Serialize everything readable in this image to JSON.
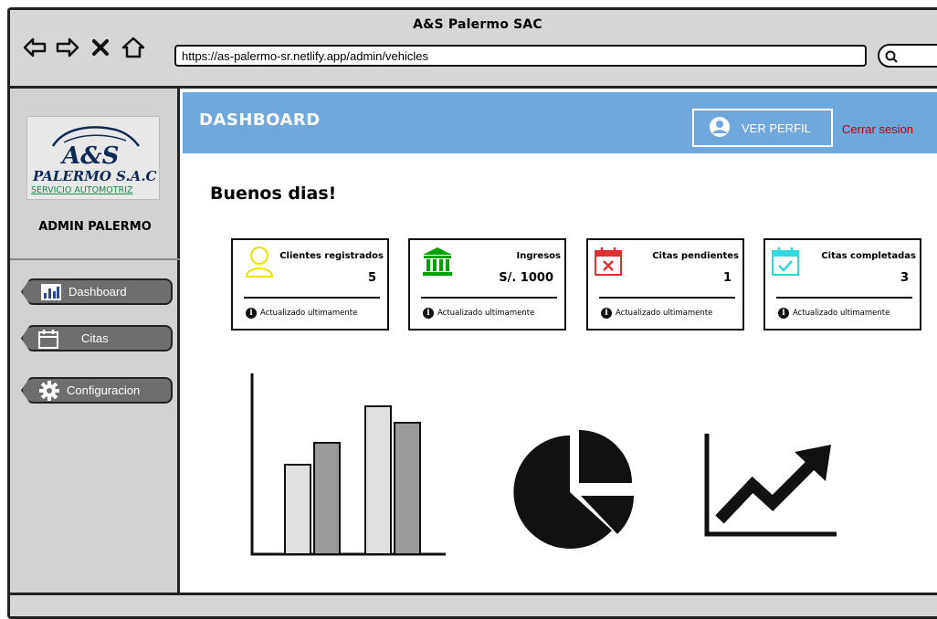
{
  "window": {
    "title": "A&S Palermo SAC",
    "url": "https://as-palermo-sr.netlify.app/admin/vehicles"
  },
  "sidebar": {
    "logo": {
      "brand": "A&S",
      "name": "PALERMO S.A.C",
      "tagline": "SERVICIO AUTOMOTRIZ"
    },
    "admin_name": "ADMIN PALERMO",
    "items": [
      {
        "label": "Dashboard",
        "icon": "bar-chart-icon"
      },
      {
        "label": "Citas",
        "icon": "calendar-icon"
      },
      {
        "label": "Configuracion",
        "icon": "gear-icon"
      }
    ]
  },
  "header": {
    "title": "DASHBOARD",
    "profile_label": "VER PERFIL",
    "logout_label": "Cerrar sesion",
    "logout_color": "#c00000",
    "bar_color": "#6fa8dc"
  },
  "greeting": "Buenos dias!",
  "cards": [
    {
      "label": "Clientes registrados",
      "value": "5",
      "footer": "Actualizado ultimamente",
      "icon": "user-icon",
      "icon_color": "#f0e000"
    },
    {
      "label": "Ingresos",
      "value": "S/. 1000",
      "footer": "Actualizado ultimamente",
      "icon": "bank-icon",
      "icon_color": "#00a000"
    },
    {
      "label": "Citas pendientes",
      "value": "1",
      "footer": "Actualizado ultimamente",
      "icon": "calendar-x-icon",
      "icon_color": "#e03030"
    },
    {
      "label": "Citas completadas",
      "value": "3",
      "footer": "Actualizado ultimamente",
      "icon": "calendar-check-icon",
      "icon_color": "#30d8e0"
    }
  ],
  "charts": [
    "bar-chart-placeholder",
    "pie-chart-placeholder",
    "trend-chart-placeholder"
  ]
}
